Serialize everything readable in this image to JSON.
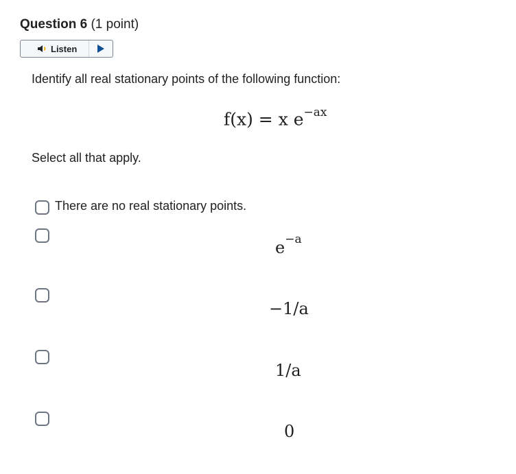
{
  "question": {
    "label": "Question 6",
    "points": "(1 point)"
  },
  "listen": {
    "label": "Listen"
  },
  "prompt": "Identify all real stationary points of the following function:",
  "formula": {
    "lhs": "f(x) = x e",
    "exponent": "−ax"
  },
  "instruction": "Select all that apply.",
  "options": [
    {
      "text": "There are no real stationary points."
    },
    {
      "base": "e",
      "exponent": "−a"
    },
    {
      "text": "−1/a"
    },
    {
      "text": "1/a"
    },
    {
      "text": "0"
    }
  ]
}
